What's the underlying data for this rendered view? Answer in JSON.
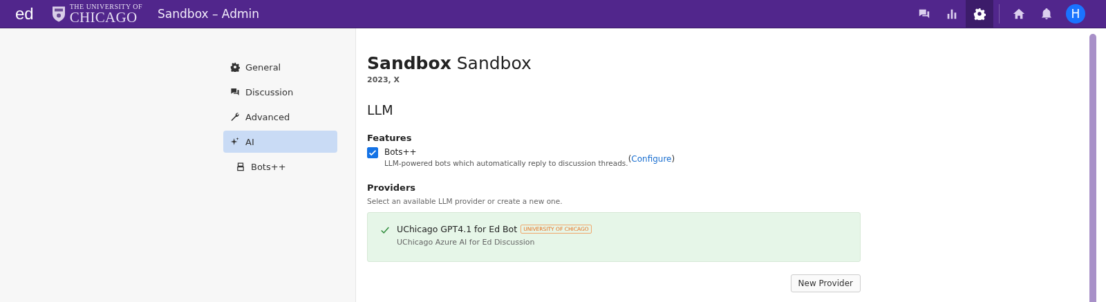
{
  "header": {
    "app": "ed",
    "logo": {
      "top": "THE UNIVERSITY OF",
      "bottom": "CHICAGO"
    },
    "title": "Sandbox – Admin",
    "icons": [
      {
        "kind": "chat",
        "selected": false
      },
      {
        "kind": "chart",
        "selected": false
      },
      {
        "kind": "gear",
        "selected": true
      },
      {
        "kind": "home",
        "selected": false
      },
      {
        "kind": "bell",
        "selected": false
      }
    ],
    "avatar": "H"
  },
  "nav": [
    {
      "label": "General",
      "kind": "gear",
      "selected": false
    },
    {
      "label": "Discussion",
      "kind": "chat",
      "selected": false
    },
    {
      "label": "Advanced",
      "kind": "wrench",
      "selected": false
    },
    {
      "label": "AI",
      "kind": "sparkle",
      "selected": true,
      "children": [
        {
          "label": "Bots++",
          "kind": "bot",
          "selected": false
        }
      ]
    }
  ],
  "course": {
    "title_bold": "Sandbox",
    "title_rest": "Sandbox",
    "subtitle": "2023, X"
  },
  "section": "LLM",
  "features": {
    "heading": "Features",
    "items": [
      {
        "label": "Bots++",
        "checked": true,
        "description": "LLM-powered bots which automatically reply to discussion threads.",
        "link_open": "(",
        "link": "Configure",
        "link_close": ")"
      }
    ]
  },
  "providers": {
    "heading": "Providers",
    "hint": "Select an available LLM provider or create a new one.",
    "items": [
      {
        "name": "UChicago GPT4.1 for Ed Bot",
        "tag": "UNIVERSITY OF CHICAGO",
        "description": "UChicago Azure AI for Ed Discussion",
        "selected": true
      }
    ],
    "button": "New Provider"
  }
}
